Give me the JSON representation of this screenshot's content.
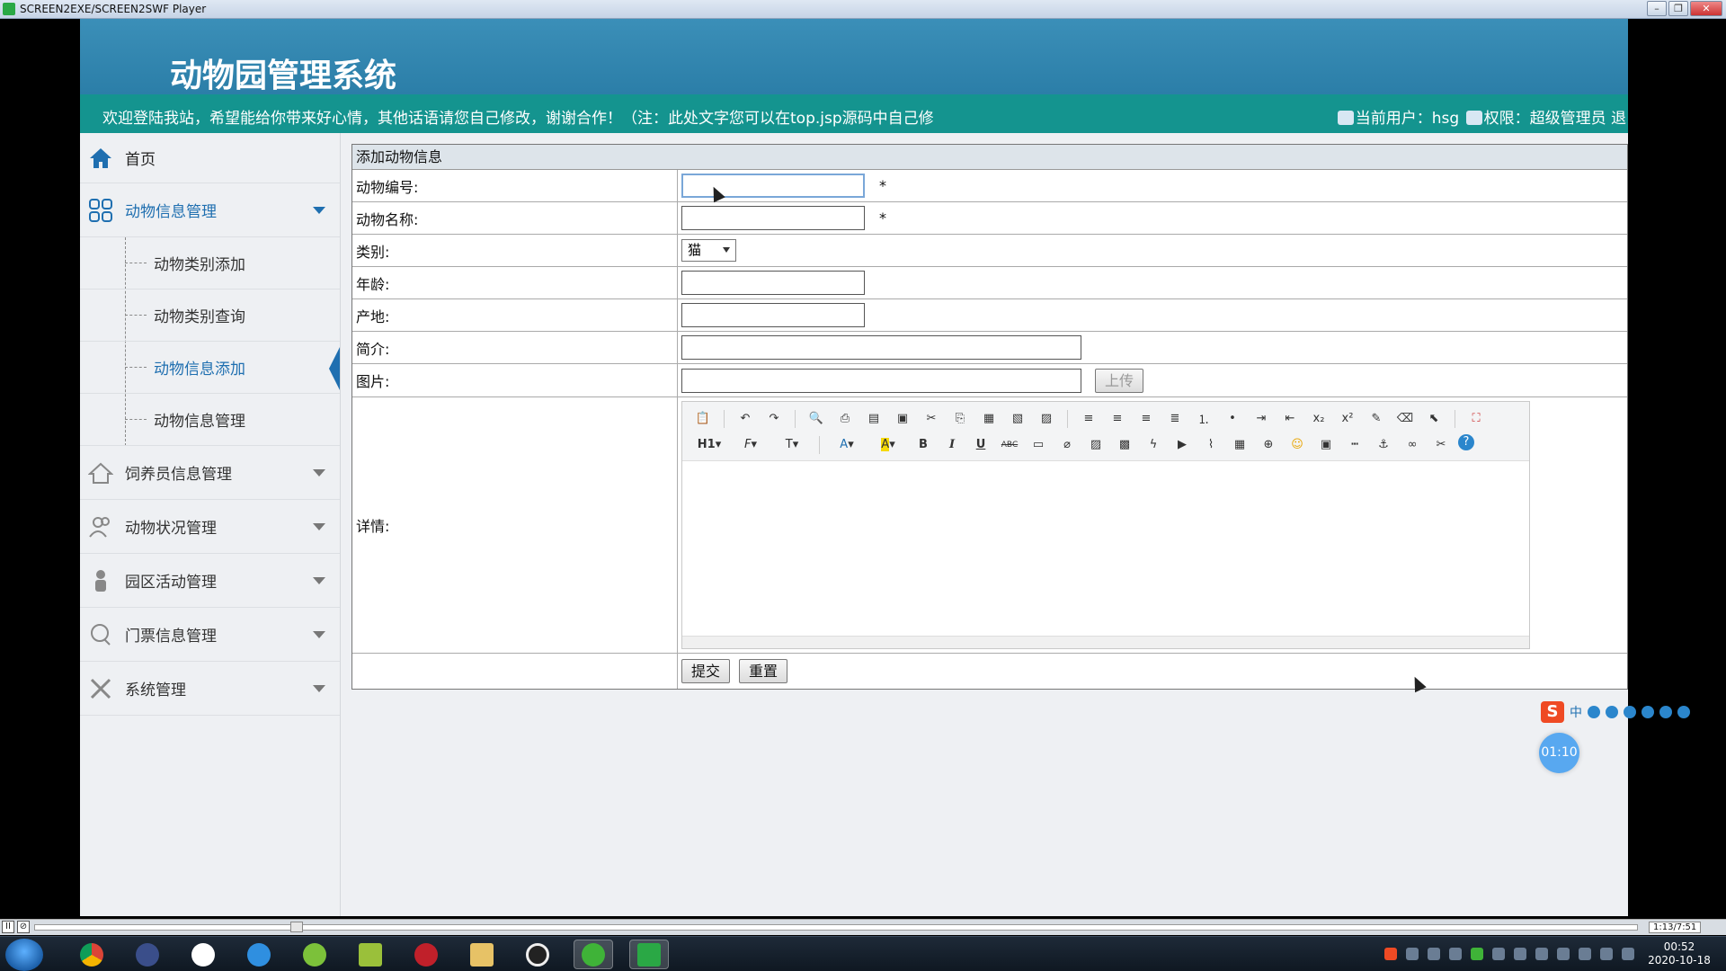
{
  "window": {
    "title": "SCREEN2EXE/SCREEN2SWF Player",
    "minimize": "–",
    "restore": "❐",
    "close": "✕"
  },
  "header": {
    "system_title": "动物园管理系统",
    "welcome_text": "欢迎登陆我站，希望能给你带来好心情，其他话语请您自己修改，谢谢合作！（注：此处文字您可以在top.jsp源码中自己修",
    "current_user": "当前用户：hsg",
    "permission": "权限：超级管理员 退"
  },
  "sidebar": {
    "home": "首页",
    "groups": [
      {
        "label": "动物信息管理",
        "icon": "grid-icon",
        "expanded": true,
        "items": [
          "动物类别添加",
          "动物类别查询",
          "动物信息添加",
          "动物信息管理"
        ],
        "active_item": "动物信息添加"
      },
      {
        "label": "饲养员信息管理",
        "icon": "house-icon"
      },
      {
        "label": "动物状况管理",
        "icon": "users-icon"
      },
      {
        "label": "园区活动管理",
        "icon": "person-icon"
      },
      {
        "label": "门票信息管理",
        "icon": "chat-icon"
      },
      {
        "label": "系统管理",
        "icon": "tools-icon"
      }
    ]
  },
  "form": {
    "title": "添加动物信息",
    "fields": {
      "animal_no": {
        "label": "动物编号:",
        "value": "",
        "required": "*"
      },
      "animal_name": {
        "label": "动物名称:",
        "value": "",
        "required": "*"
      },
      "category": {
        "label": "类别:",
        "selected": "猫"
      },
      "age": {
        "label": "年龄:",
        "value": ""
      },
      "origin": {
        "label": "产地:",
        "value": ""
      },
      "intro": {
        "label": "简介:",
        "value": ""
      },
      "image": {
        "label": "图片:",
        "value": "",
        "upload_label": "上传"
      },
      "details": {
        "label": "详情:"
      }
    },
    "submit_label": "提交",
    "reset_label": "重置"
  },
  "editor_toolbar": {
    "row1": [
      "paste-icon",
      "undo-icon",
      "redo-icon",
      "preview-icon",
      "print-icon",
      "template-icon",
      "select-all-icon",
      "cut-icon",
      "copy-icon",
      "paste-plain-icon",
      "paste-text-icon",
      "paste-word-icon",
      "align-left-icon",
      "align-center-icon",
      "align-right-icon",
      "align-justify-icon",
      "ordered-list-icon",
      "unordered-list-icon",
      "indent-icon",
      "outdent-icon",
      "subscript-icon",
      "superscript-icon",
      "format-brush-icon",
      "clear-format-icon",
      "select-icon",
      "fullscreen-icon"
    ],
    "row2_labels": {
      "heading": "H1",
      "font": "F",
      "size": "T",
      "font_color": "A",
      "bg_color": "A",
      "bold": "B",
      "italic": "I",
      "underline": "U",
      "strike": "ABC"
    },
    "row2_icons": [
      "hr-icon",
      "eraser-icon",
      "image-icon",
      "multi-image-icon",
      "flash-icon",
      "media-icon",
      "attachment-icon",
      "table-icon",
      "insert-icon",
      "emoticon-icon",
      "map-icon",
      "pagebreak-icon",
      "anchor-icon",
      "link-icon",
      "unlink-icon",
      "help-icon"
    ]
  },
  "overlay": {
    "ime_logo": "S",
    "ime_lang": "中",
    "timer": "01:10"
  },
  "player": {
    "pause": "II",
    "stop": "⊘",
    "time": "1:13/7:51",
    "progress": 0.16
  },
  "taskbar": {
    "clock_time": "00:52",
    "clock_date": "2020-10-18"
  },
  "colors": {
    "header": "#2b7ea8",
    "banner": "#14948f",
    "active": "#1f6fb0"
  }
}
